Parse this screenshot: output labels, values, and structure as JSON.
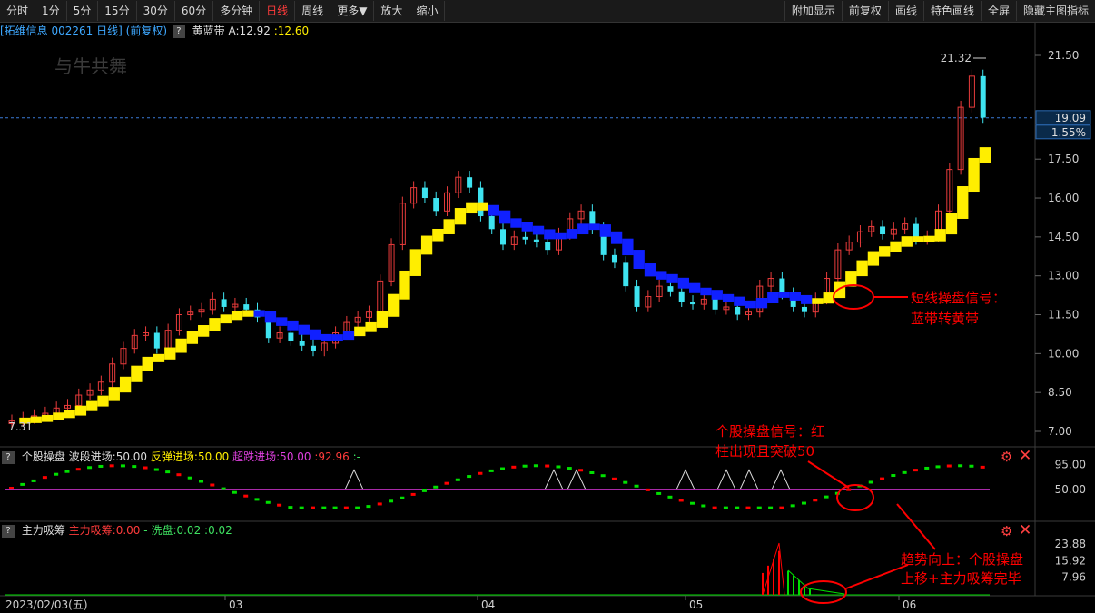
{
  "toolbar": {
    "left": [
      "分时",
      "1分",
      "5分",
      "15分",
      "30分",
      "60分",
      "多分钟",
      "日线",
      "周线",
      "更多▼",
      "放大",
      "缩小"
    ],
    "active_index": 7,
    "right": [
      "附加显示",
      "前复权",
      "画线",
      "特色画线",
      "全屏",
      "隐藏主图指标"
    ]
  },
  "main_info": {
    "stock": "[拓维信息 002261 日线]",
    "adj": "(前复权)",
    "indicator": "黄蓝带",
    "a_label": "A:12.92",
    "val2": ":12.60"
  },
  "watermark": "与牛共舞",
  "price_axis": [
    "21.50",
    "17.50",
    "16.00",
    "14.50",
    "13.00",
    "11.50",
    "10.00",
    "8.50",
    "7.00"
  ],
  "price_axis_values": [
    21.5,
    17.5,
    16.0,
    14.5,
    13.0,
    11.5,
    10.0,
    8.5,
    7.0
  ],
  "current_price": "19.09",
  "current_pct": "-1.55%",
  "high_label": "21.32",
  "low_label": "7.31",
  "ann_main": [
    "短线操盘信号：",
    "蓝带转黄带"
  ],
  "ann_mid": [
    "个股操盘信号：红",
    "柱出现且突破50"
  ],
  "ann_sub": [
    "趋势向上：个股操盘",
    "上移+主力吸筹完毕"
  ],
  "sub1_info": {
    "name": "个股操盘",
    "a": "波段进场:50.00",
    "b": "反弹进场:50.00",
    "c": "超跌进场:50.00",
    "d": ":92.96",
    "e": ":-"
  },
  "sub1_axis": [
    "95.00",
    "50.00"
  ],
  "sub2_info": {
    "name": "主力吸筹",
    "a": "主力吸筹:0.00",
    "b": "-",
    "c": "洗盘:0.02",
    "d": ":0.02"
  },
  "sub2_axis": [
    "23.88",
    "15.92",
    "7.96"
  ],
  "date_axis": [
    "2023/02/03(五)",
    "03",
    "04",
    "05",
    "06"
  ],
  "colors": {
    "up": "#e83b3b",
    "down": "#3ee3f0",
    "yellow": "#ffee00",
    "blue": "#1020ff",
    "magenta": "#c030c0",
    "green": "#00e000",
    "red": "#ff0000"
  }
}
